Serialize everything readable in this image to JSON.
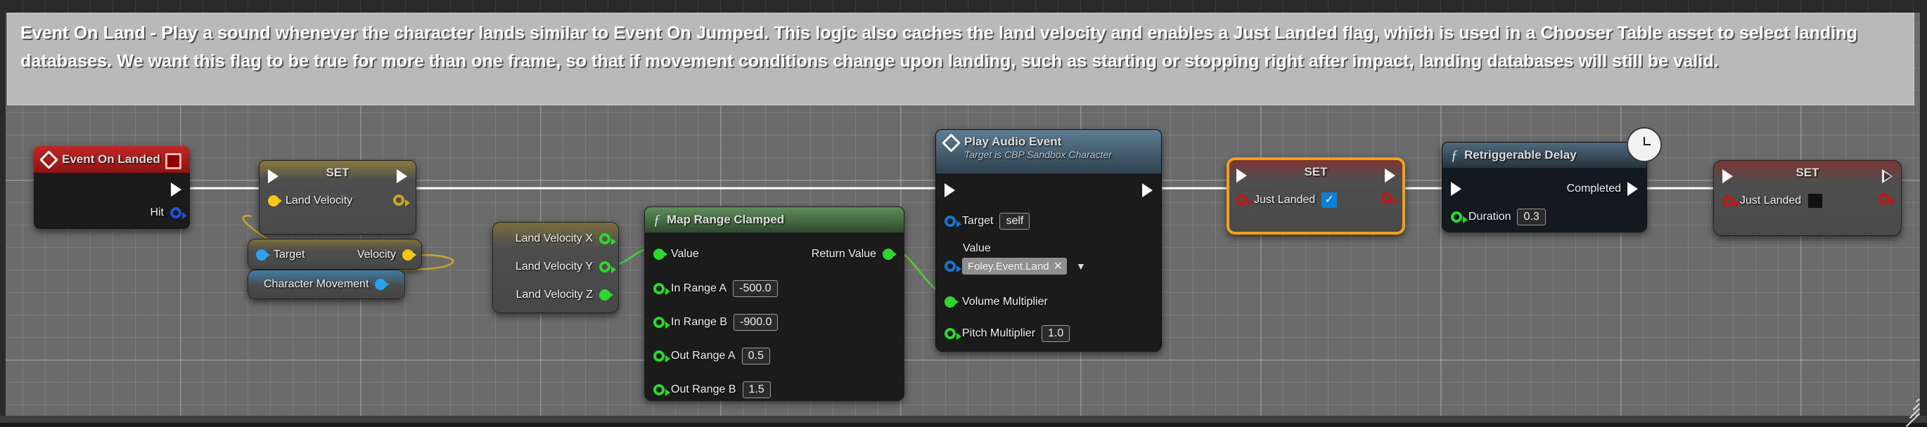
{
  "comment": {
    "text": "Event On Land - Play a sound whenever the character lands similar to Event On Jumped. This logic also caches the land velocity and enables a Just Landed flag, which is used in a Chooser Table asset to select landing databases. We want this flag to be true for more than one frame, so that if movement conditions change upon landing, such as starting or stopping right after impact, landing databases will still be valid."
  },
  "nodes": {
    "event_on_landed": {
      "title": "Event On Landed",
      "icon": "event-diamond-icon",
      "delete_badge": "red-square-icon",
      "out_pins": [
        {
          "label": "",
          "type": "exec"
        },
        {
          "label": "Hit",
          "type": "struct"
        }
      ]
    },
    "set_land_velocity": {
      "title": "SET",
      "pins": [
        {
          "label": "Land Velocity",
          "type": "vector"
        }
      ]
    },
    "get_character_movement": {
      "title": "",
      "pins": [
        {
          "label": "Target",
          "type": "object"
        },
        {
          "label": "Velocity",
          "type": "vector"
        }
      ],
      "self_pin": "Character Movement"
    },
    "break_land_velocity": {
      "title": "",
      "out_pins": [
        {
          "label": "Land Velocity X",
          "type": "float"
        },
        {
          "label": "Land Velocity Y",
          "type": "float"
        },
        {
          "label": "Land Velocity Z",
          "type": "float"
        }
      ]
    },
    "map_range_clamped": {
      "title": "Map Range Clamped",
      "icon": "function-f-icon",
      "in_pins": [
        {
          "label": "Value",
          "value": ""
        },
        {
          "label": "In Range A",
          "value": "-500.0"
        },
        {
          "label": "In Range B",
          "value": "-900.0"
        },
        {
          "label": "Out Range A",
          "value": "0.5"
        },
        {
          "label": "Out Range B",
          "value": "1.5"
        }
      ],
      "out_pins": [
        {
          "label": "Return Value"
        }
      ]
    },
    "play_audio_event": {
      "title": "Play Audio Event",
      "subtitle": "Target is CBP Sandbox Character",
      "icon": "event-diamond-icon",
      "in_pins": [
        {
          "label": "Target",
          "value": "self"
        },
        {
          "label": "Value",
          "value": "Foley.Event.Land"
        },
        {
          "label": "Volume Multiplier",
          "value": ""
        },
        {
          "label": "Pitch Multiplier",
          "value": "1.0"
        }
      ]
    },
    "set_just_landed_true": {
      "title": "SET",
      "selected": true,
      "selection_color": "#f0a01e",
      "pins": [
        {
          "label": "Just Landed",
          "value": true
        }
      ]
    },
    "retriggerable_delay": {
      "title": "Retriggerable Delay",
      "icon": "function-f-icon",
      "badge": "clock-icon",
      "in_pins": [
        {
          "label": "Duration",
          "value": "0.3"
        }
      ],
      "out_pins": [
        {
          "label": "Completed"
        }
      ]
    },
    "set_just_landed_false": {
      "title": "SET",
      "pins": [
        {
          "label": "Just Landed",
          "value": false
        }
      ]
    }
  },
  "colors": {
    "exec_wire": "#ffffff",
    "vector_pin": "#f5c518",
    "object_pin": "#2aa3ef",
    "float_pin": "#2fd62f",
    "bool_pin": "#c01616",
    "struct_pin": "#1f4fd8",
    "selection": "#f0a01e"
  }
}
